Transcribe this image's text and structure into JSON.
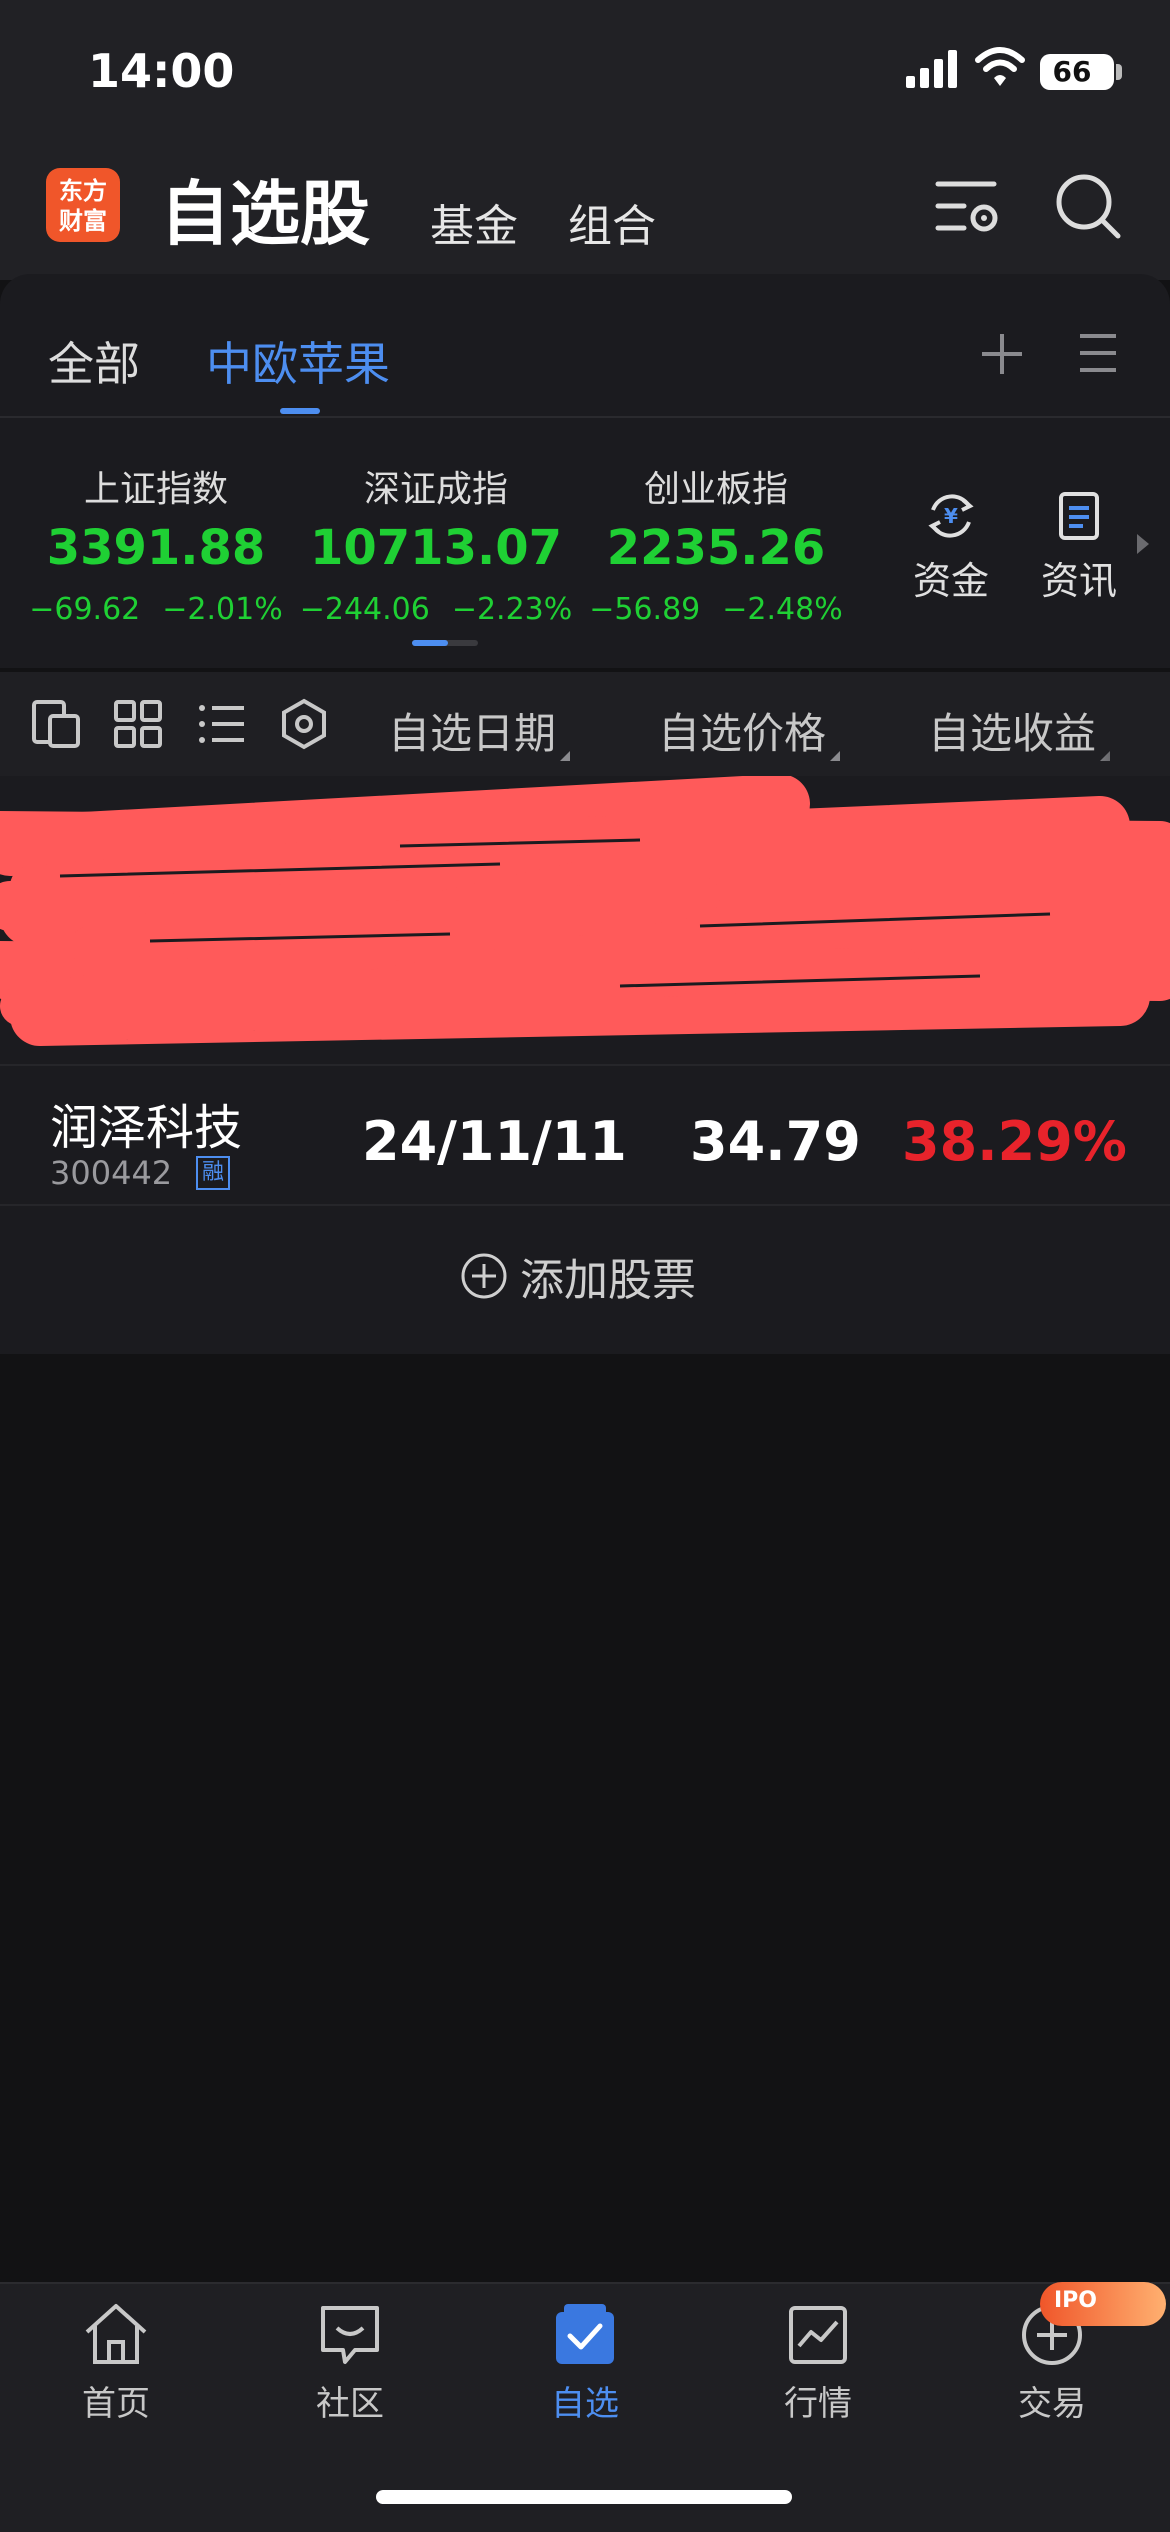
{
  "status_bar": {
    "time": "14:00",
    "battery": "66"
  },
  "header": {
    "logo_line1": "东方",
    "logo_line2": "财富",
    "title": "自选股",
    "tabs": [
      "基金",
      "组合"
    ]
  },
  "groups": {
    "tabs": [
      "全部",
      "中欧苹果"
    ],
    "active": "中欧苹果"
  },
  "indices": [
    {
      "name": "上证指数",
      "value": "3391.88",
      "change": "−69.62",
      "pct": "−2.01%"
    },
    {
      "name": "深证成指",
      "value": "10713.07",
      "change": "−244.06",
      "pct": "−2.23%"
    },
    {
      "name": "创业板指",
      "value": "2235.26",
      "change": "−56.89",
      "pct": "−2.48%"
    }
  ],
  "shortcuts": [
    {
      "label": "资金",
      "icon": "funds-flow-icon"
    },
    {
      "label": "资讯",
      "icon": "news-icon"
    }
  ],
  "toolbar": {
    "columns": [
      "自选日期",
      "自选价格",
      "自选收益"
    ]
  },
  "stocks": [
    {
      "name": "润泽科技",
      "code": "300442",
      "tag": "融",
      "date": "24/11/11",
      "price": "34.79",
      "gain": "38.29%"
    }
  ],
  "add_stock_label": "添加股票",
  "nav": {
    "items": [
      "首页",
      "社区",
      "自选",
      "行情",
      "交易"
    ],
    "active": "自选",
    "badge": "IPO"
  },
  "colors": {
    "accent": "#4d8ef0",
    "down": "#1fd034",
    "up": "#e8232b",
    "brand": "#f0562a",
    "redaction": "#ff5a5a"
  }
}
